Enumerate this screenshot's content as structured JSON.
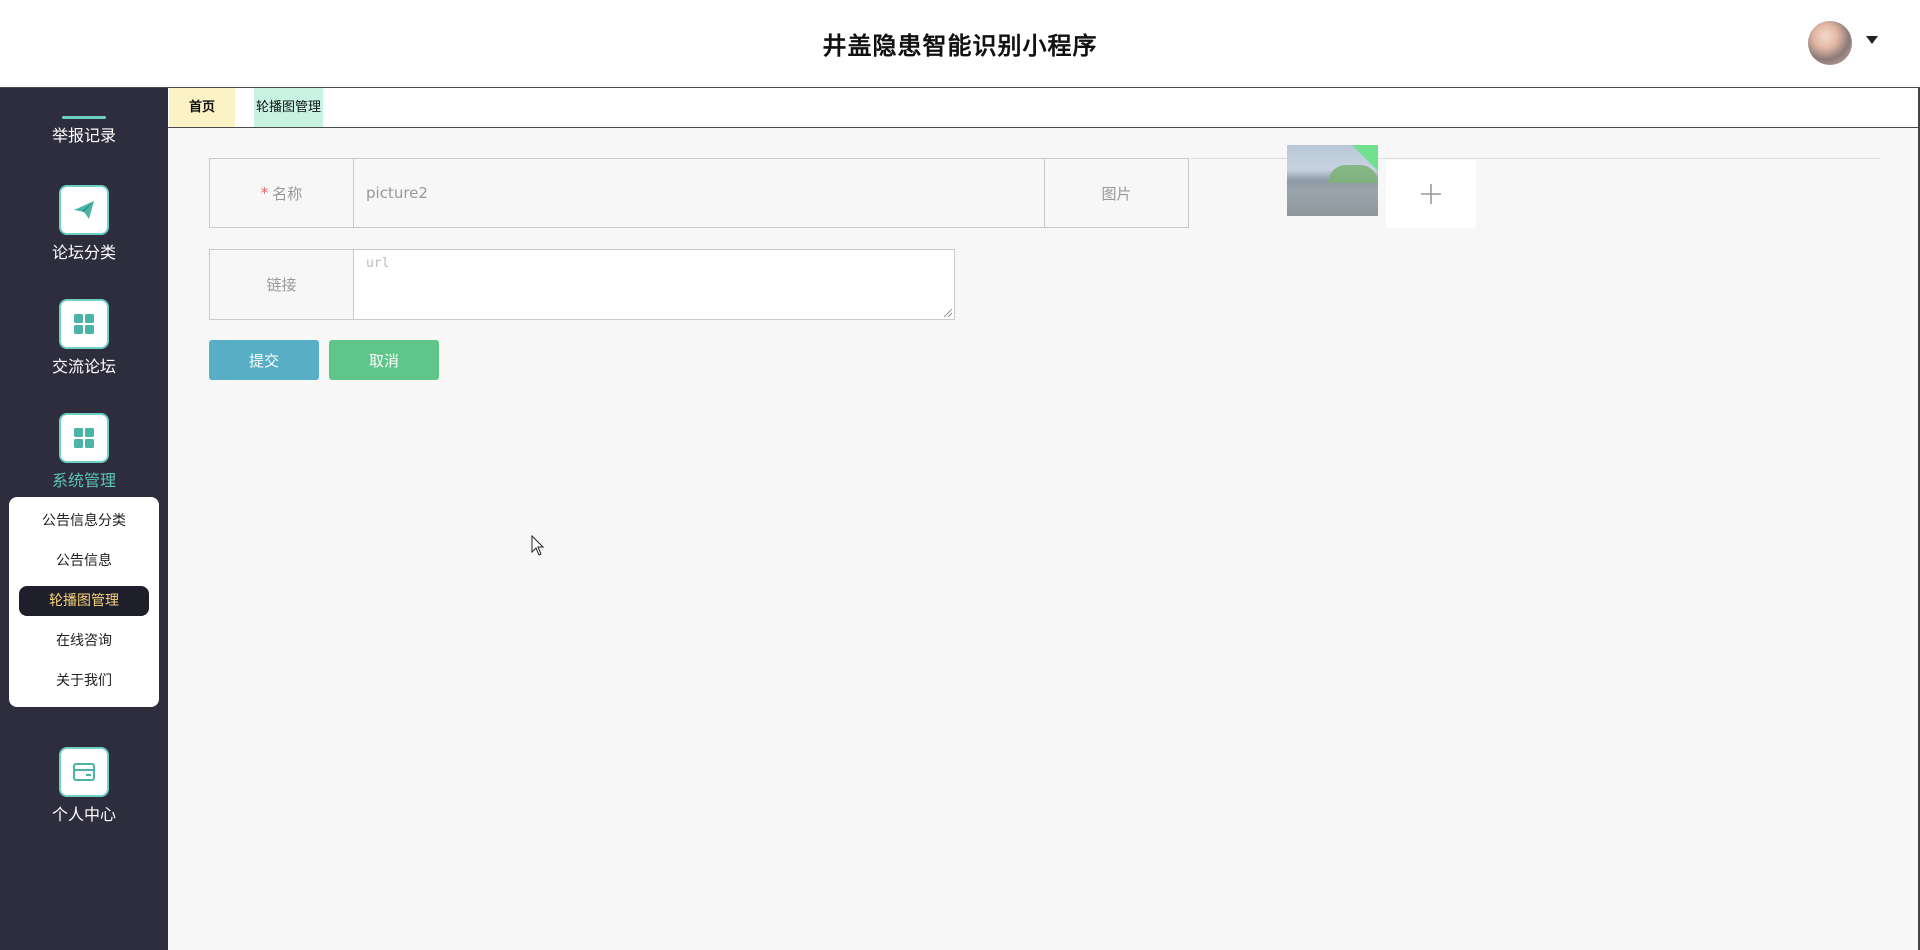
{
  "header": {
    "title": "井盖隐患智能识别小程序"
  },
  "sidebar": {
    "top_label": "举报记录",
    "items": [
      {
        "label": "论坛分类",
        "icon": "paper-plane-icon"
      },
      {
        "label": "交流论坛",
        "icon": "grid-icon"
      },
      {
        "label": "系统管理",
        "icon": "grid-icon",
        "active": true
      },
      {
        "label": "个人中心",
        "icon": "card-icon"
      }
    ],
    "submenu": [
      "公告信息分类",
      "公告信息",
      "轮播图管理",
      "在线咨询",
      "关于我们"
    ],
    "submenu_active": "轮播图管理"
  },
  "tabs": [
    {
      "label": "首页"
    },
    {
      "label": "轮播图管理",
      "active": true
    }
  ],
  "form": {
    "name_required_mark": "*",
    "name_label": "名称",
    "name_value": "picture2",
    "image_label": "图片",
    "link_label": "链接",
    "link_placeholder": "url"
  },
  "buttons": {
    "submit": "提交",
    "cancel": "取消"
  },
  "colors": {
    "sidebar_bg": "#2d2d3d",
    "accent": "#5ec4b6",
    "submit": "#58aec4",
    "cancel": "#5fc68a"
  }
}
